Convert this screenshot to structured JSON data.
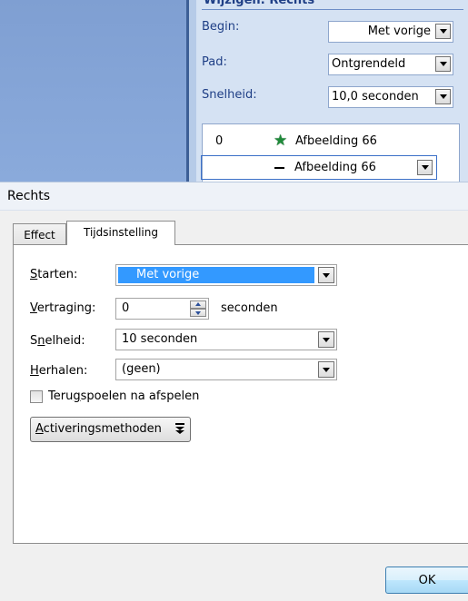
{
  "task_pane": {
    "header": "Wijzigen: Rechts",
    "begin_label": "Begin:",
    "begin_value": "Met vorige",
    "path_label": "Pad:",
    "path_value": "Ontgrendeld",
    "speed_label": "Snelheid:",
    "speed_value": "10,0 seconden",
    "animations": [
      {
        "number": "0",
        "icon": "green-star-icon",
        "name": "Afbeelding 66"
      },
      {
        "number": "",
        "icon": "line-dash-icon",
        "name": "Afbeelding 66"
      }
    ]
  },
  "dialog": {
    "title": "Rechts",
    "tabs": [
      {
        "label": "Effect",
        "active": false
      },
      {
        "label": "Tijdsinstelling",
        "active": true
      }
    ],
    "start": {
      "label_key": "S",
      "label_rest": "tarten:",
      "value": "Met vorige"
    },
    "delay": {
      "label_key": "V",
      "label_rest": "ertraging:",
      "value": "0",
      "unit": "seconden"
    },
    "speed": {
      "label_pre": "S",
      "label_key": "n",
      "label_rest": "elheid:",
      "value": "10 seconden"
    },
    "repeat": {
      "label_key": "H",
      "label_rest": "erhalen:",
      "value": "(geen)"
    },
    "rewind": {
      "label_pre": "Teru",
      "label_key": "g",
      "label_rest": "spoelen na afspelen",
      "checked": false
    },
    "triggers_button": {
      "label_key": "A",
      "label_rest": "ctiveringsmethoden"
    },
    "ok_label": "OK"
  },
  "colors": {
    "selection": "#3399ff",
    "pane_bg": "#d5e2f3",
    "pane_text": "#1f3f86",
    "star": "#1f8a3a"
  }
}
